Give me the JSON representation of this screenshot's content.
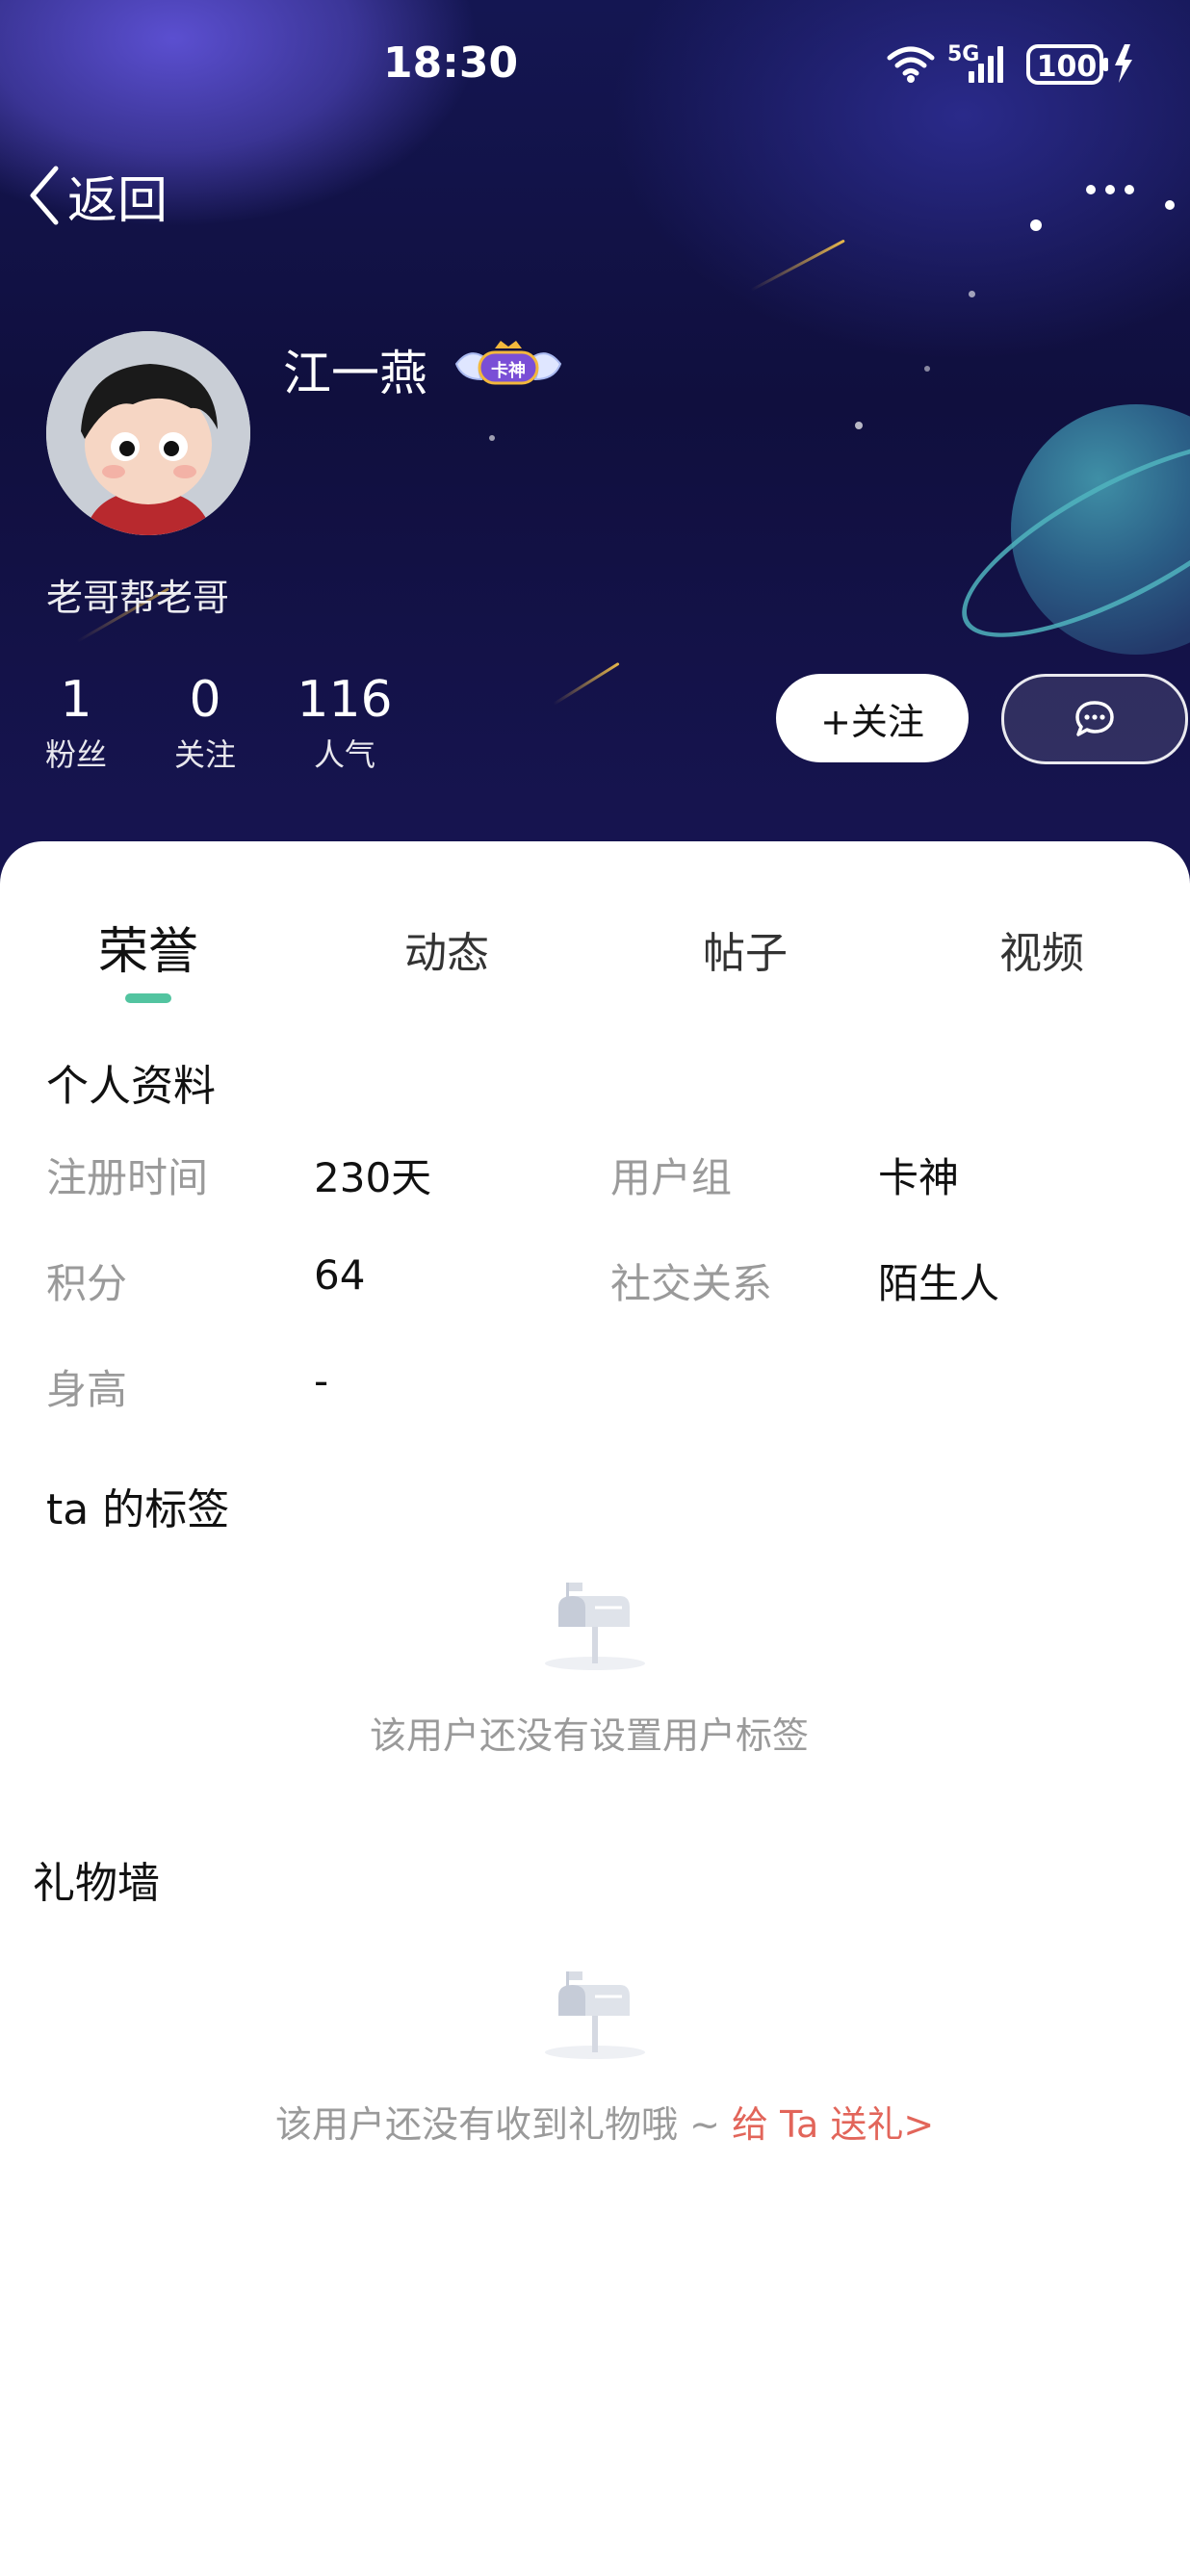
{
  "status_bar": {
    "time": "18:30",
    "network": "5G",
    "battery": "100"
  },
  "nav": {
    "back_label": "返回",
    "more_icon": "more-horizontal-icon"
  },
  "profile": {
    "nickname": "江一燕",
    "badge_text": "卡神",
    "signature": "老哥帮老哥",
    "stats": [
      {
        "value": "1",
        "label": "粉丝"
      },
      {
        "value": "0",
        "label": "关注"
      },
      {
        "value": "116",
        "label": "人气"
      }
    ],
    "follow_label": "+关注",
    "message_icon": "chat-bubble-icon"
  },
  "tabs": [
    {
      "label": "荣誉",
      "active": true
    },
    {
      "label": "动态",
      "active": false
    },
    {
      "label": "帖子",
      "active": false
    },
    {
      "label": "视频",
      "active": false
    }
  ],
  "personal_info": {
    "title": "个人资料",
    "fields": [
      {
        "label": "注册时间",
        "value": "230天"
      },
      {
        "label": "用户组",
        "value": "卡神"
      },
      {
        "label": "积分",
        "value": "64"
      },
      {
        "label": "社交关系",
        "value": "陌生人"
      },
      {
        "label": "身高",
        "value": "-"
      }
    ]
  },
  "tags_section": {
    "title": "ta 的标签",
    "empty_text": "该用户还没有设置用户标签"
  },
  "gift_wall": {
    "title": "礼物墙",
    "empty_text": "该用户还没有收到礼物哦 ~ ",
    "gift_link": "给 Ta 送礼>"
  },
  "colors": {
    "accent": "#52c4a0",
    "link": "#e2655a",
    "hero_bg": "#141652"
  }
}
